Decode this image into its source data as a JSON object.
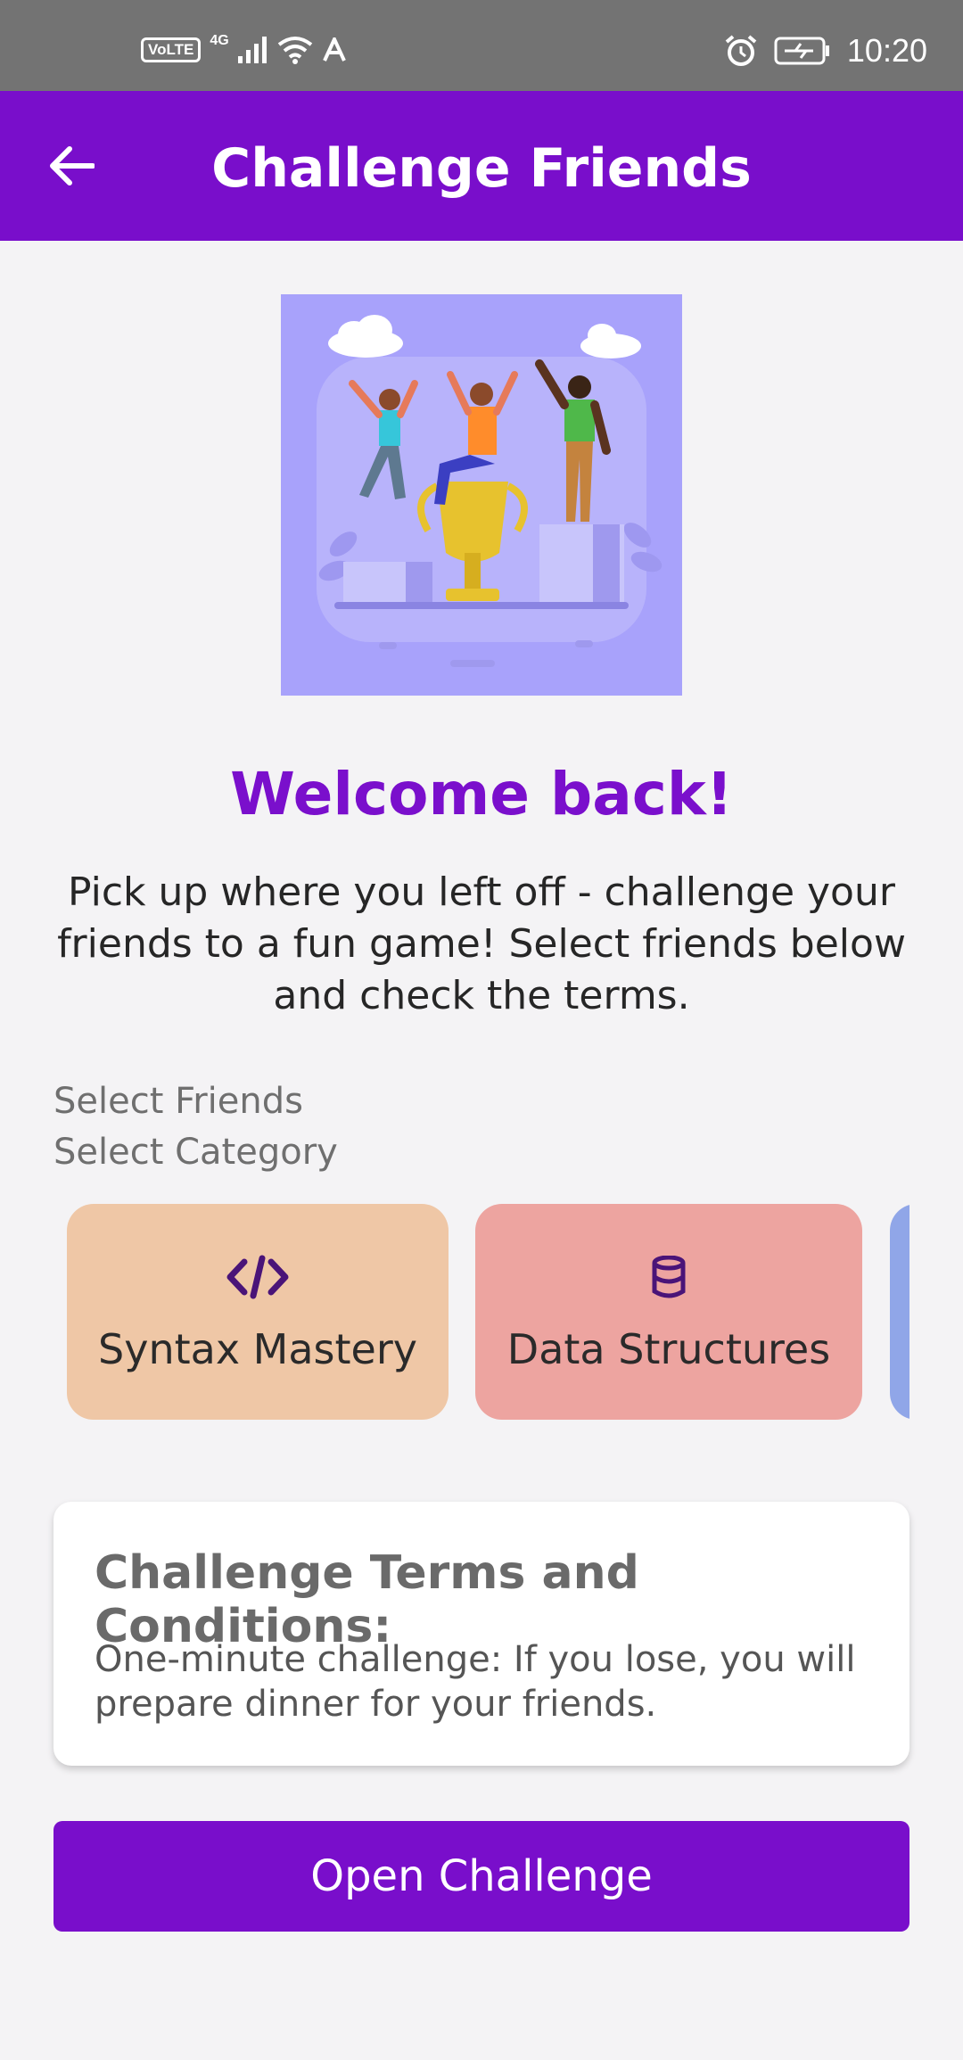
{
  "status_bar": {
    "volte": "VoLTE",
    "network": "4G",
    "time": "10:20"
  },
  "app_bar": {
    "title": "Challenge Friends",
    "back_icon": "arrow-left-icon"
  },
  "hero": {
    "illustration": "three-friends-celebrating-trophy"
  },
  "welcome": {
    "title": "Welcome back!",
    "body": "Pick up where you left off - challenge your friends to a fun game! Select friends below and check the terms."
  },
  "labels": {
    "select_friends": "Select Friends",
    "select_category": "Select Category"
  },
  "categories": [
    {
      "label": "Syntax Mastery",
      "icon": "code-icon",
      "color": "#efc7a6"
    },
    {
      "label": "Data Structures",
      "icon": "database-icon",
      "color": "#eda4a0"
    },
    {
      "label": "",
      "icon": "",
      "color": "#90a6e8"
    }
  ],
  "terms": {
    "title": "Challenge Terms and Conditions:",
    "body": "One-minute challenge: If you lose, you will prepare dinner for your friends."
  },
  "action": {
    "open_label": "Open Challenge"
  },
  "colors": {
    "primary": "#790ecb",
    "background": "#f4f3f5"
  }
}
